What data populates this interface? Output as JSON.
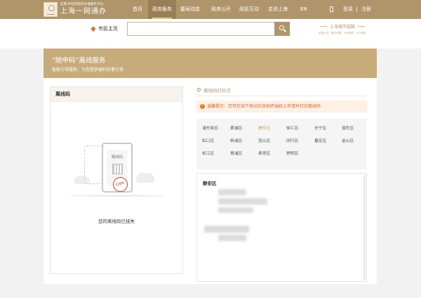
{
  "header": {
    "logo_sub": "官网·供在民政府办理服务平台",
    "logo_main": "上海一网通办",
    "nav": [
      "首页",
      "政务服务",
      "要闻动态",
      "政务公开",
      "政民互动",
      "走进上海",
      "EN"
    ],
    "active_nav": "政务服务",
    "login": "登录",
    "register": "注册",
    "colors": {
      "bar": "#b0956a",
      "active": "#9a7f55"
    }
  },
  "search": {
    "location": "市民主页",
    "query": "",
    "placeholder": ""
  },
  "brand": {
    "title": "上海城市超脑",
    "sub": "智能引导 · 隐在便捷 · 开启服务 · 大气便民"
  },
  "banner": {
    "title": "“随申码”离线服务",
    "subtitle": "智能引导服务，为您提供便利办事引导"
  },
  "left_card": {
    "title": "离线码",
    "phone_label": "离线码",
    "stamp": "已挂失",
    "message": "您的离线码已挂失"
  },
  "right_panel": {
    "header": "离线码打印点",
    "notice": "温馨提示：您可在如下地点的自助终端机上申请并打印离线码",
    "districts": [
      "浦东新区",
      "黄浦区",
      "静安区",
      "徐汇区",
      "长宁区",
      "普陀区",
      "虹口区",
      "杨浦区",
      "宝山区",
      "闵行区",
      "嘉定区",
      "金山区",
      "松江区",
      "青浦区",
      "奉贤区",
      "崇明区"
    ],
    "selected_district": "静安区",
    "result_title": "静安区"
  }
}
